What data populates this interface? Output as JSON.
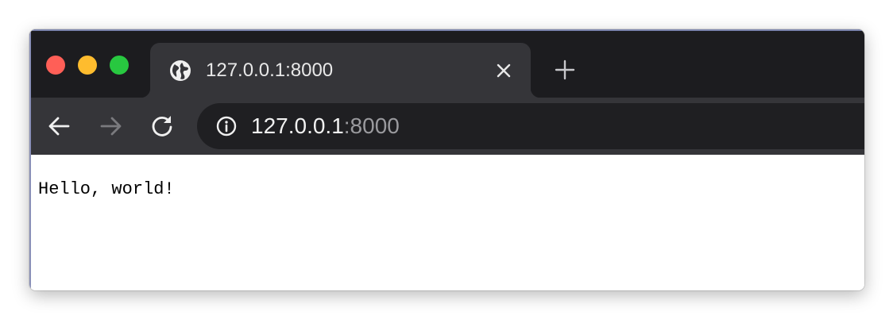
{
  "window": {
    "traffic_lights": {
      "close_color": "#ff5f57",
      "minimize_color": "#febc2e",
      "zoom_color": "#28c840"
    }
  },
  "tab": {
    "icon": "globe-icon",
    "title": "127.0.0.1:8000",
    "close_icon": "close-icon"
  },
  "tabbar": {
    "new_tab_icon": "plus-icon"
  },
  "toolbar": {
    "back_icon": "arrow-left-icon",
    "forward_icon": "arrow-right-icon",
    "reload_icon": "reload-icon",
    "forward_enabled": false
  },
  "omnibox": {
    "security_icon": "info-icon",
    "host": "127.0.0.1",
    "port": ":8000"
  },
  "page": {
    "text": "Hello, world!"
  },
  "colors": {
    "titlebar_bg": "#1c1c1f",
    "tab_bg": "#353539",
    "toolbar_bg": "#353539",
    "omnibox_bg": "#1f1f22"
  }
}
